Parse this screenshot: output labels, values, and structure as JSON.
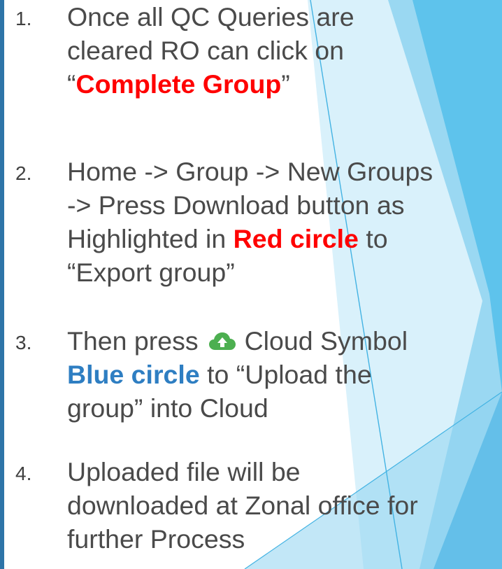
{
  "steps": [
    {
      "number": "1.",
      "line1": "Once all QC Queries are",
      "line2": "cleared RO can click on",
      "line3_open_quote": "“",
      "line3_highlight": "Complete Group",
      "line3_close_quote": "”"
    },
    {
      "number": "2.",
      "line1": "Home -> Group -> New Groups",
      "line2": "-> Press Download button as",
      "line3_pre": "Highlighted in ",
      "line3_highlight": "Red circle",
      "line3_post": " to",
      "line4": "“Export group”"
    },
    {
      "number": "3.",
      "line1_pre": "Then press",
      "line1_post": "Cloud Symbol",
      "line2_highlight": "Blue circle",
      "line2_post": " to “Upload the",
      "line3": "group” into Cloud"
    },
    {
      "number": "4.",
      "line1": "Uploaded file will be",
      "line2": "downloaded at Zonal office for",
      "line3": "further Process"
    }
  ],
  "icons": {
    "cloud_upload": "cloud-upload-icon"
  },
  "colors": {
    "text": "#4a4a4a",
    "highlight_red": "#ff0000",
    "highlight_blue": "#2e7ec2",
    "cloud_icon": "#4caf50",
    "accent_dark": "#2e9fd8",
    "accent_light": "#bfe6f6"
  }
}
